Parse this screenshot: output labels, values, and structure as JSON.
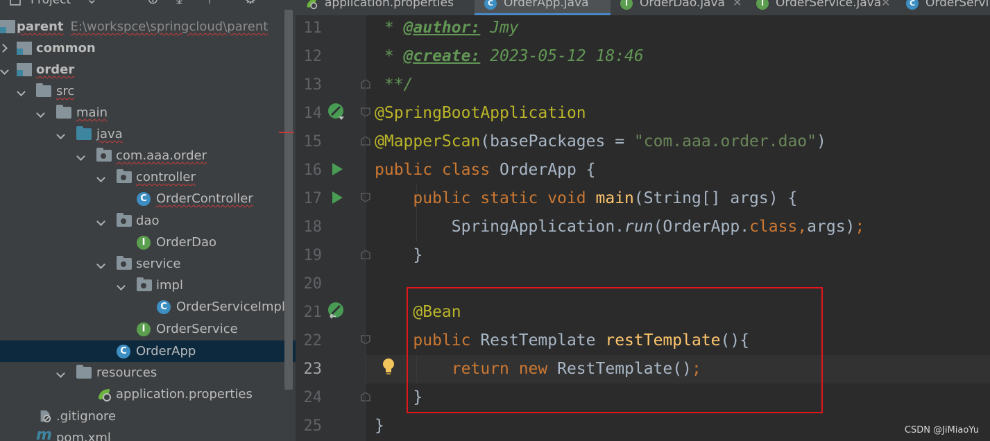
{
  "project_panel": {
    "title": "Project",
    "tree": [
      {
        "label": "parent",
        "path": "E:\\workspce\\springcloud\\parent",
        "icon": "module-icon"
      },
      {
        "label": "common",
        "icon": "module-icon"
      },
      {
        "label": "order",
        "icon": "module-icon"
      },
      {
        "label": "src",
        "icon": "folder-icon"
      },
      {
        "label": "main",
        "icon": "folder-icon"
      },
      {
        "label": "java",
        "icon": "source-folder-icon"
      },
      {
        "label": "com.aaa.order",
        "icon": "package-icon"
      },
      {
        "label": "controller",
        "icon": "package-icon"
      },
      {
        "label": "OrderController",
        "icon": "class-icon"
      },
      {
        "label": "dao",
        "icon": "package-icon"
      },
      {
        "label": "OrderDao",
        "icon": "interface-icon"
      },
      {
        "label": "service",
        "icon": "package-icon"
      },
      {
        "label": "impl",
        "icon": "package-icon"
      },
      {
        "label": "OrderServiceImpl",
        "icon": "class-icon"
      },
      {
        "label": "OrderService",
        "icon": "interface-icon"
      },
      {
        "label": "OrderApp",
        "icon": "spring-boot-class-icon"
      },
      {
        "label": "resources",
        "icon": "resources-folder-icon"
      },
      {
        "label": "application.properties",
        "icon": "spring-properties-icon"
      },
      {
        "label": ".gitignore",
        "icon": "gitignore-icon"
      },
      {
        "label": "pom.xml",
        "icon": "maven-icon"
      }
    ],
    "selected": "OrderApp"
  },
  "tabs": [
    {
      "label": "application.properties",
      "icon": "spring-properties-icon",
      "active": false
    },
    {
      "label": "OrderApp.java",
      "icon": "spring-boot-class-icon",
      "active": true
    },
    {
      "label": "OrderDao.java",
      "icon": "interface-icon",
      "active": false
    },
    {
      "label": "OrderService.java",
      "icon": "interface-icon",
      "active": false
    },
    {
      "label": "OrderServi",
      "icon": "class-icon",
      "active": false
    }
  ],
  "editor": {
    "current_line": "23",
    "line_numbers": [
      "11",
      "12",
      "13",
      "14",
      "15",
      "16",
      "17",
      "18",
      "19",
      "20",
      "21",
      "22",
      "23",
      "24",
      "25"
    ],
    "code": {
      "l11_star": " * ",
      "l11_tag": "@author:",
      "l11_val": " Jmy",
      "l12_star": " * ",
      "l12_tag": "@create:",
      "l12_val": " 2023-05-12 18:46",
      "l13": " **/",
      "l14": "@SpringBootApplication",
      "l15_ann": "@MapperScan",
      "l15_a": "(basePackages = ",
      "l15_str": "\"com.aaa.order.dao\"",
      "l15_b": ")",
      "l16_kw": "public class ",
      "l16_rest": "OrderApp {",
      "l17_kw": "    public static void ",
      "l17_fn": "main",
      "l17_rest": "(String[] args) {",
      "l18_a": "        SpringApplication.",
      "l18_it": "run",
      "l18_b": "(OrderApp.",
      "l18_kw": "class",
      "l18_comma": ",",
      "l18_c": "args)",
      "l18_semi": ";",
      "l19": "    }",
      "l20": "",
      "l21": "    @Bean",
      "l22_kw": "    public ",
      "l22_type": "RestTemplate ",
      "l22_fn": "restTemplate",
      "l22_rest": "(){",
      "l23_kw": "        return new ",
      "l23_rest": "RestTemplate()",
      "l23_semi": ";",
      "l24": "    }",
      "l25": "}"
    }
  },
  "watermark": "CSDN @JiMiaoYu",
  "colors": {
    "keyword": "#cc7832",
    "annotation": "#bbb529",
    "string": "#6a8759",
    "doc_comment": "#629755",
    "function": "#ffc66d",
    "highlight_box": "#e3161b"
  }
}
